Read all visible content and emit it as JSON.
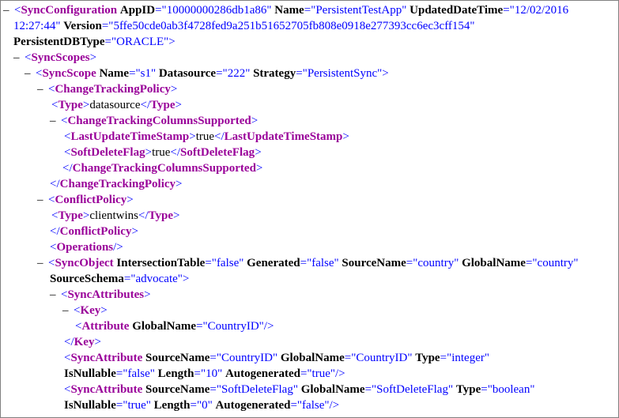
{
  "colors": {
    "tag": "#990099",
    "punct": "#0000ff",
    "attr_value": "#0000ff",
    "attr_name": "#000000"
  },
  "lines": [
    [
      [
        "toggle",
        "–"
      ],
      [
        "p",
        "<"
      ],
      [
        "tag",
        "SyncConfiguration"
      ],
      [
        "t",
        " "
      ],
      [
        "an",
        "AppID"
      ],
      [
        "p",
        "=\""
      ],
      [
        "av",
        "10000000286db1a86"
      ],
      [
        "p",
        "\""
      ],
      [
        "t",
        " "
      ],
      [
        "an",
        "Name"
      ],
      [
        "p",
        "=\""
      ],
      [
        "av",
        "PersistentTestApp"
      ],
      [
        "p",
        "\""
      ],
      [
        "t",
        " "
      ],
      [
        "an",
        "UpdatedDateTime"
      ],
      [
        "p",
        "=\""
      ],
      [
        "av",
        "12/02/2016"
      ]
    ],
    [
      [
        "av",
        "12:27:44"
      ],
      [
        "p",
        "\""
      ],
      [
        "t",
        " "
      ],
      [
        "an",
        "Version"
      ],
      [
        "p",
        "=\""
      ],
      [
        "av",
        "5ffe50cde0ab3f4728fed9a251b51652705fb808e0918e277393cc6ec3cff154"
      ],
      [
        "p",
        "\""
      ]
    ],
    [
      [
        "an",
        "PersistentDBType"
      ],
      [
        "p",
        "=\""
      ],
      [
        "av",
        "ORACLE"
      ],
      [
        "p",
        "\">"
      ]
    ],
    [
      [
        "toggle",
        "–"
      ],
      [
        "p",
        "<"
      ],
      [
        "tag",
        "SyncScopes"
      ],
      [
        "p",
        ">"
      ]
    ],
    [
      [
        "toggle",
        "–"
      ],
      [
        "p",
        "<"
      ],
      [
        "tag",
        "SyncScope"
      ],
      [
        "t",
        " "
      ],
      [
        "an",
        "Name"
      ],
      [
        "p",
        "=\""
      ],
      [
        "av",
        "s1"
      ],
      [
        "p",
        "\""
      ],
      [
        "t",
        " "
      ],
      [
        "an",
        "Datasource"
      ],
      [
        "p",
        "=\""
      ],
      [
        "av",
        "222"
      ],
      [
        "p",
        "\""
      ],
      [
        "t",
        " "
      ],
      [
        "an",
        "Strategy"
      ],
      [
        "p",
        "=\""
      ],
      [
        "av",
        "PersistentSync"
      ],
      [
        "p",
        "\">"
      ]
    ],
    [
      [
        "toggle",
        "–"
      ],
      [
        "p",
        "<"
      ],
      [
        "tag",
        "ChangeTrackingPolicy"
      ],
      [
        "p",
        ">"
      ]
    ],
    [
      [
        "p",
        "<"
      ],
      [
        "tag",
        "Type"
      ],
      [
        "p",
        ">"
      ],
      [
        "t",
        "datasource"
      ],
      [
        "p",
        "</"
      ],
      [
        "tag",
        "Type"
      ],
      [
        "p",
        ">"
      ]
    ],
    [
      [
        "toggle",
        "–"
      ],
      [
        "p",
        "<"
      ],
      [
        "tag",
        "ChangeTrackingColumnsSupported"
      ],
      [
        "p",
        ">"
      ]
    ],
    [
      [
        "p",
        "<"
      ],
      [
        "tag",
        "LastUpdateTimeStamp"
      ],
      [
        "p",
        ">"
      ],
      [
        "t",
        "true"
      ],
      [
        "p",
        "</"
      ],
      [
        "tag",
        "LastUpdateTimeStamp"
      ],
      [
        "p",
        ">"
      ]
    ],
    [
      [
        "p",
        "<"
      ],
      [
        "tag",
        "SoftDeleteFlag"
      ],
      [
        "p",
        ">"
      ],
      [
        "t",
        "true"
      ],
      [
        "p",
        "</"
      ],
      [
        "tag",
        "SoftDeleteFlag"
      ],
      [
        "p",
        ">"
      ]
    ],
    [
      [
        "p",
        "</"
      ],
      [
        "tag",
        "ChangeTrackingColumnsSupported"
      ],
      [
        "p",
        ">"
      ]
    ],
    [
      [
        "p",
        "</"
      ],
      [
        "tag",
        "ChangeTrackingPolicy"
      ],
      [
        "p",
        ">"
      ]
    ],
    [
      [
        "toggle",
        "–"
      ],
      [
        "p",
        "<"
      ],
      [
        "tag",
        "ConflictPolicy"
      ],
      [
        "p",
        ">"
      ]
    ],
    [
      [
        "p",
        "<"
      ],
      [
        "tag",
        "Type"
      ],
      [
        "p",
        ">"
      ],
      [
        "t",
        "clientwins"
      ],
      [
        "p",
        "</"
      ],
      [
        "tag",
        "Type"
      ],
      [
        "p",
        ">"
      ]
    ],
    [
      [
        "p",
        "</"
      ],
      [
        "tag",
        "ConflictPolicy"
      ],
      [
        "p",
        ">"
      ]
    ],
    [
      [
        "p",
        "<"
      ],
      [
        "tag",
        "Operations"
      ],
      [
        "p",
        "/>"
      ]
    ],
    [
      [
        "toggle",
        "–"
      ],
      [
        "p",
        "<"
      ],
      [
        "tag",
        "SyncObject"
      ],
      [
        "t",
        " "
      ],
      [
        "an",
        "IntersectionTable"
      ],
      [
        "p",
        "=\""
      ],
      [
        "av",
        "false"
      ],
      [
        "p",
        "\""
      ],
      [
        "t",
        " "
      ],
      [
        "an",
        "Generated"
      ],
      [
        "p",
        "=\""
      ],
      [
        "av",
        "false"
      ],
      [
        "p",
        "\""
      ],
      [
        "t",
        " "
      ],
      [
        "an",
        "SourceName"
      ],
      [
        "p",
        "=\""
      ],
      [
        "av",
        "country"
      ],
      [
        "p",
        "\""
      ],
      [
        "t",
        " "
      ],
      [
        "an",
        "GlobalName"
      ],
      [
        "p",
        "=\""
      ],
      [
        "av",
        "country"
      ],
      [
        "p",
        "\""
      ]
    ],
    [
      [
        "an",
        "SourceSchema"
      ],
      [
        "p",
        "=\""
      ],
      [
        "av",
        "advocate"
      ],
      [
        "p",
        "\">"
      ]
    ],
    [
      [
        "toggle",
        "–"
      ],
      [
        "p",
        "<"
      ],
      [
        "tag",
        "SyncAttributes"
      ],
      [
        "p",
        ">"
      ]
    ],
    [
      [
        "toggle",
        "–"
      ],
      [
        "p",
        "<"
      ],
      [
        "tag",
        "Key"
      ],
      [
        "p",
        ">"
      ]
    ],
    [
      [
        "p",
        "<"
      ],
      [
        "tag",
        "Attribute"
      ],
      [
        "t",
        " "
      ],
      [
        "an",
        "GlobalName"
      ],
      [
        "p",
        "=\""
      ],
      [
        "av",
        "CountryID"
      ],
      [
        "p",
        "\"/>"
      ]
    ],
    [
      [
        "p",
        "</"
      ],
      [
        "tag",
        "Key"
      ],
      [
        "p",
        ">"
      ]
    ],
    [
      [
        "p",
        "<"
      ],
      [
        "tag",
        "SyncAttribute"
      ],
      [
        "t",
        " "
      ],
      [
        "an",
        "SourceName"
      ],
      [
        "p",
        "=\""
      ],
      [
        "av",
        "CountryID"
      ],
      [
        "p",
        "\""
      ],
      [
        "t",
        " "
      ],
      [
        "an",
        "GlobalName"
      ],
      [
        "p",
        "=\""
      ],
      [
        "av",
        "CountryID"
      ],
      [
        "p",
        "\""
      ],
      [
        "t",
        " "
      ],
      [
        "an",
        "Type"
      ],
      [
        "p",
        "=\""
      ],
      [
        "av",
        "integer"
      ],
      [
        "p",
        "\""
      ]
    ],
    [
      [
        "an",
        "IsNullable"
      ],
      [
        "p",
        "=\""
      ],
      [
        "av",
        "false"
      ],
      [
        "p",
        "\""
      ],
      [
        "t",
        " "
      ],
      [
        "an",
        "Length"
      ],
      [
        "p",
        "=\""
      ],
      [
        "av",
        "10"
      ],
      [
        "p",
        "\""
      ],
      [
        "t",
        " "
      ],
      [
        "an",
        "Autogenerated"
      ],
      [
        "p",
        "=\""
      ],
      [
        "av",
        "true"
      ],
      [
        "p",
        "\"/>"
      ]
    ],
    [
      [
        "p",
        "<"
      ],
      [
        "tag",
        "SyncAttribute"
      ],
      [
        "t",
        " "
      ],
      [
        "an",
        "SourceName"
      ],
      [
        "p",
        "=\""
      ],
      [
        "av",
        "SoftDeleteFlag"
      ],
      [
        "p",
        "\""
      ],
      [
        "t",
        " "
      ],
      [
        "an",
        "GlobalName"
      ],
      [
        "p",
        "=\""
      ],
      [
        "av",
        "SoftDeleteFlag"
      ],
      [
        "p",
        "\""
      ],
      [
        "t",
        " "
      ],
      [
        "an",
        "Type"
      ],
      [
        "p",
        "=\""
      ],
      [
        "av",
        "boolean"
      ],
      [
        "p",
        "\""
      ]
    ],
    [
      [
        "an",
        "IsNullable"
      ],
      [
        "p",
        "=\""
      ],
      [
        "av",
        "true"
      ],
      [
        "p",
        "\""
      ],
      [
        "t",
        " "
      ],
      [
        "an",
        "Length"
      ],
      [
        "p",
        "=\""
      ],
      [
        "av",
        "0"
      ],
      [
        "p",
        "\""
      ],
      [
        "t",
        " "
      ],
      [
        "an",
        "Autogenerated"
      ],
      [
        "p",
        "=\""
      ],
      [
        "av",
        "false"
      ],
      [
        "p",
        "\"/>"
      ]
    ]
  ]
}
